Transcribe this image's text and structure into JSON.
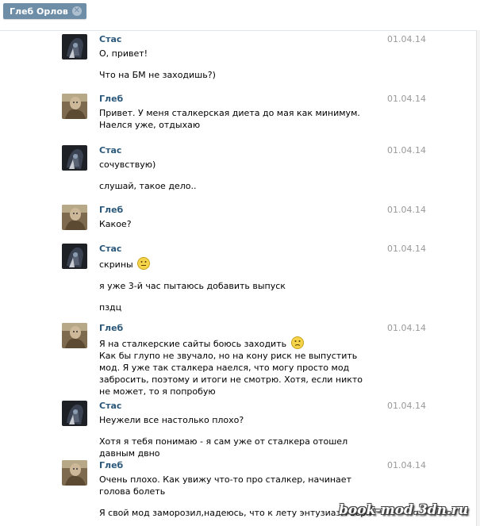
{
  "tab": {
    "label": "Глеб Орлов",
    "close_icon": "close-icon"
  },
  "messages": [
    {
      "author": "Стас",
      "avatar": "avatar-stas",
      "date": "01.04.14",
      "lines": [
        "О, привет!",
        "",
        "Что на БМ не заходишь?)"
      ]
    },
    {
      "author": "Глеб",
      "avatar": "avatar-gleb",
      "date": "01.04.14",
      "lines": [
        "Привет. У меня сталкерская диета до мая как минимум. Наелся уже, отдыхаю"
      ]
    },
    {
      "author": "Стас",
      "avatar": "avatar-stas",
      "date": "01.04.14",
      "lines": [
        "сочувствую)",
        "",
        "слушай, такое дело.."
      ]
    },
    {
      "author": "Глеб",
      "avatar": "avatar-gleb",
      "date": "01.04.14",
      "lines": [
        "Какое?"
      ]
    },
    {
      "author": "Стас",
      "avatar": "avatar-stas",
      "date": "01.04.14",
      "lines": [
        "скрины",
        "",
        "я уже 3-й час пытаюсь добавить выпуск",
        "",
        "пздц"
      ]
    },
    {
      "author": "Глеб",
      "avatar": "avatar-gleb",
      "date": "01.04.14",
      "lines": [
        "Я на сталкерские сайты боюсь заходить",
        "Как бы глупо не звучало, но на кону риск не выпустить мод. Я уже так сталкера наелся, что могу просто мод забросить, поэтому и итоги не смотрю. Хотя, если никто не может, то я попробую"
      ]
    },
    {
      "author": "Стас",
      "avatar": "avatar-stas",
      "date": "01.04.14",
      "lines": [
        "Неужели все настолько плохо?",
        "",
        "Хотя я тебя понимаю - я сам уже от сталкера отошел давным двно"
      ]
    },
    {
      "author": "Глеб",
      "avatar": "avatar-gleb",
      "date": "01.04.14",
      "lines": [
        "Очень плохо. Как увижу что-то про сталкер, начинает голова болеть",
        "",
        "Я свой мод заморозил,надеюсь, что к лету энтузиазм верн"
      ]
    }
  ],
  "watermark": "book-mod.3dn.ru"
}
